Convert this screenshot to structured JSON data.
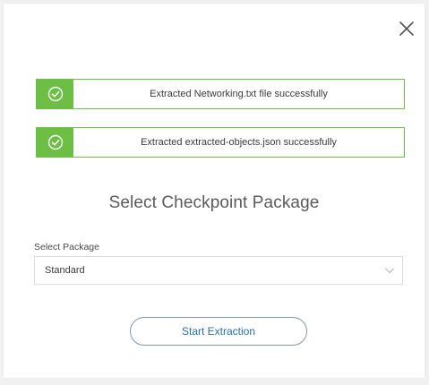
{
  "dialog": {
    "close_label": "×"
  },
  "notifications": [
    {
      "icon": "check-circle-icon",
      "text": "Extracted Networking.txt file successfully"
    },
    {
      "icon": "check-circle-icon",
      "text": "Extracted extracted-objects.json successfully"
    }
  ],
  "heading": "Select Checkpoint Package",
  "package_select": {
    "label": "Select Package",
    "value": "Standard",
    "icon": "chevron-down-icon"
  },
  "actions": {
    "start_label": "Start Extraction"
  },
  "colors": {
    "success": "#6cbe45",
    "button_text": "#2b6f9e",
    "button_border": "#7f98ab",
    "heading_text": "#5b5b5b"
  }
}
